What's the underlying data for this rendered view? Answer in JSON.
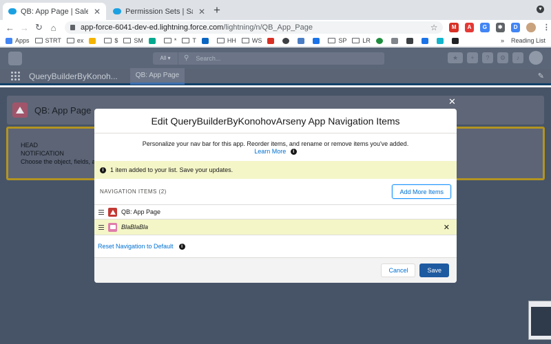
{
  "browser": {
    "tabs": [
      {
        "title": "QB: App Page | Salesforce",
        "active": true
      },
      {
        "title": "Permission Sets | Salesforce",
        "active": false
      }
    ],
    "url_host": "app-force-6041-dev-ed.lightning.force.com",
    "url_path": "/lightning/n/QB_App_Page",
    "bookmarks": [
      "Apps",
      "STRT",
      "ex",
      "$",
      "SM",
      "*",
      "T",
      "HH",
      "WS",
      "SP",
      "LR"
    ],
    "bookmark_more": "»",
    "reading_list": "Reading List"
  },
  "sf": {
    "search_scope": "All",
    "search_placeholder": "Search...",
    "app_name": "QueryBuilderByKonoh...",
    "app_tab": "QB: App Page",
    "page_title": "QB: App Page",
    "notification_lines": [
      "HEAD",
      "NOTIFICATION",
      "Choose the object, fields, an"
    ]
  },
  "modal": {
    "title": "Edit QueryBuilderByKonohovArseny App Navigation Items",
    "intro": "Personalize your nav bar for this app. Reorder items, and rename or remove items you've added.",
    "learn_more": "Learn More",
    "toast": "1 item added to your list. Save your updates.",
    "nav_items_label": "NAVIGATION ITEMS (2)",
    "add_more": "Add More Items",
    "items": [
      {
        "label": "QB: App Page",
        "icon": "triangle-icon"
      },
      {
        "label": "BlaBlaBla",
        "icon": "folder-icon"
      }
    ],
    "reset": "Reset Navigation to Default",
    "cancel": "Cancel",
    "save": "Save"
  }
}
